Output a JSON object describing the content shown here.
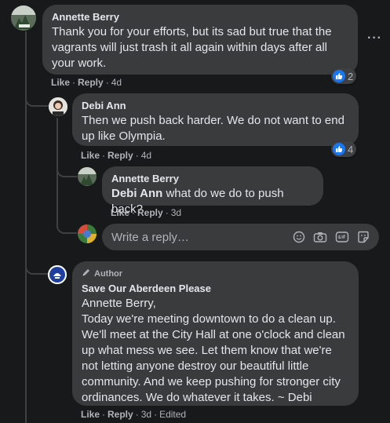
{
  "comments": [
    {
      "author": "Annette Berry",
      "text": "Thank you for your efforts, but its sad but true that the vagrants will just trash it all again within days after all your work.",
      "like_label": "Like",
      "reply_label": "Reply",
      "time": "4d",
      "reaction_count": "2"
    },
    {
      "author": "Debi Ann",
      "text": "Then we push back harder. We do not want to end up like Olympia.",
      "like_label": "Like",
      "reply_label": "Reply",
      "time": "4d",
      "reaction_count": "4"
    },
    {
      "author": "Annette Berry",
      "mention": "Debi Ann",
      "text": " what do we do to push back?",
      "like_label": "Like",
      "reply_label": "Reply",
      "time": "3d"
    },
    {
      "badge": "Author",
      "author": "Save Our Aberdeen Please",
      "text": "Annette Berry,\nToday we're meeting downtown to do a clean up. We'll meet at the City Hall at one o'clock and clean up what mess we see. Let them know that we're not letting anyone destroy our beautiful little community. And we keep pushing for stronger city ordinances. We do whatever it takes. ~ Debi",
      "like_label": "Like",
      "reply_label": "Reply",
      "time": "3d",
      "edited": "Edited"
    }
  ],
  "reply_box": {
    "placeholder": "Write a reply…"
  },
  "more_options": "···",
  "separator": "·",
  "colors": {
    "background": "#18191a",
    "bubble": "#3a3b3c",
    "like_blue": "#1877f2",
    "muted_text": "#b0b3b8"
  },
  "icons": [
    "like-icon",
    "more-options-icon",
    "emoji-icon",
    "camera-icon",
    "gif-icon",
    "sticker-icon",
    "pencil-icon"
  ]
}
